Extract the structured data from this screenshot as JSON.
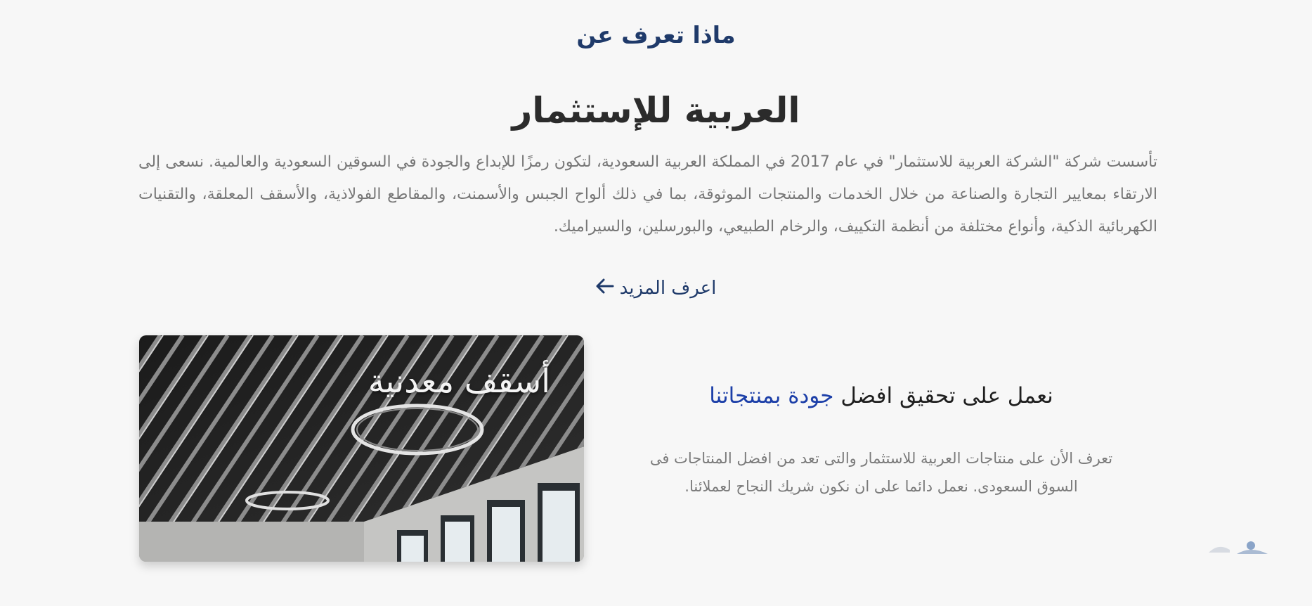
{
  "section": {
    "eyebrow": "ماذا تعرف عن",
    "headline": "العربية للإستثمار",
    "intro": "تأسست شركة \"الشركة العربية للاستثمار\" في عام 2017 في المملكة العربية السعودية، لتكون رمزًا للإبداع والجودة في السوقين السعودية والعالمية. نسعى إلى الارتقاء بمعايير التجارة والصناعة من خلال الخدمات والمنتجات الموثوقة، بما في ذلك ألواح الجبس والأسمنت، والمقاطع الفولاذية، والأسقف المعلقة، والتقنيات الكهربائية الذكية، وأنواع مختلفة من أنظمة التكييف، والرخام الطبيعي، والبورسلين، والسيراميك.",
    "more_label": "اعرف المزيد",
    "more_icon": "arrow-left-icon"
  },
  "product_card": {
    "title": "أسقف معدنية"
  },
  "quality": {
    "title_prefix": "نعمل على تحقيق افضل",
    "title_accent": "جودة بمنتجاتنا",
    "text": "تعرف الأن على منتاجات العربية للاستثمار والتى تعد من افضل المنتاجات فى السوق السعودى. نعمل دائما على ان نكون شريك النجاح لعملائنا."
  },
  "colors": {
    "accent": "#1c3fa8",
    "heading_blue": "#1f3a6a",
    "background": "#f7f7f7"
  }
}
